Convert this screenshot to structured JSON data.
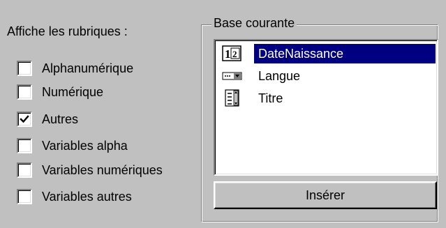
{
  "left_panel": {
    "heading": "Affiche les rubriques :",
    "checkboxes": [
      {
        "label": "Alphanumérique",
        "checked": false
      },
      {
        "label": "Numérique",
        "checked": false
      },
      {
        "label": "Autres",
        "checked": true
      },
      {
        "label": "Variables alpha",
        "checked": false
      },
      {
        "label": "Variables numériques",
        "checked": false
      },
      {
        "label": "Variables autres",
        "checked": false
      }
    ]
  },
  "group": {
    "title": "Base courante",
    "list_items": [
      {
        "label": "DateNaissance",
        "icon": "numeric-field-icon",
        "selected": true
      },
      {
        "label": "Langue",
        "icon": "dropdown-field-icon",
        "selected": false
      },
      {
        "label": "Titre",
        "icon": "text-field-icon",
        "selected": false
      }
    ],
    "insert_button": "Insérer"
  },
  "colors": {
    "window_bg": "#c0c0c0",
    "selection_bg": "#000080",
    "selection_text": "#ffffff"
  }
}
